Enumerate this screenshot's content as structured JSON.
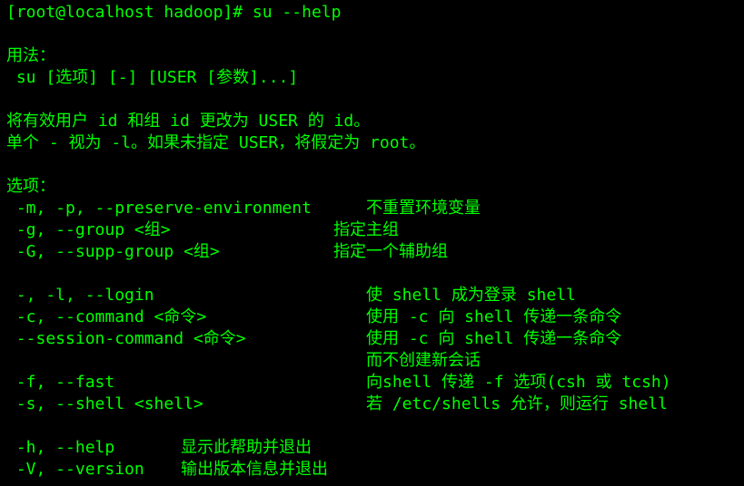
{
  "terminal": {
    "prompt": "[root@localhost hadoop]# su --help",
    "usage_title": "用法：",
    "usage": " su [选项] [-] [USER [参数]...]",
    "desc1": "将有效用户 id 和组 id 更改为 USER 的 id。",
    "desc2": "单个 - 视为 -l。如果未指定 USER，将假定为 root。",
    "options_title": "选项：",
    "options": [
      {
        "flag": " -m, -p, --preserve-environment",
        "desc": "不重置环境变量"
      },
      {
        "flag": " -g, --group <组>",
        "desc": "指定主组"
      },
      {
        "flag": " -G, --supp-group <组>",
        "desc": "指定一个辅助组"
      },
      {
        "flag": " -, -l, --login",
        "desc": "使 shell 成为登录 shell"
      },
      {
        "flag": " -c, --command <命令>",
        "desc": "使用 -c 向 shell 传递一条命令"
      },
      {
        "flag": " --session-command <命令>",
        "desc": "使用 -c 向 shell 传递一条命令"
      },
      {
        "flag": "",
        "desc": "而不创建新会话"
      },
      {
        "flag": " -f, --fast",
        "desc": "向shell 传递 -f 选项(csh 或 tcsh)"
      },
      {
        "flag": " -s, --shell <shell>",
        "desc": "若 /etc/shells 允许，则运行 shell"
      },
      {
        "flag": " -h, --help",
        "desc": "显示此帮助并退出"
      },
      {
        "flag": " -V, --version",
        "desc": "输出版本信息并退出"
      }
    ]
  },
  "colors": {
    "background": "#000000",
    "text": "#00ff00"
  }
}
